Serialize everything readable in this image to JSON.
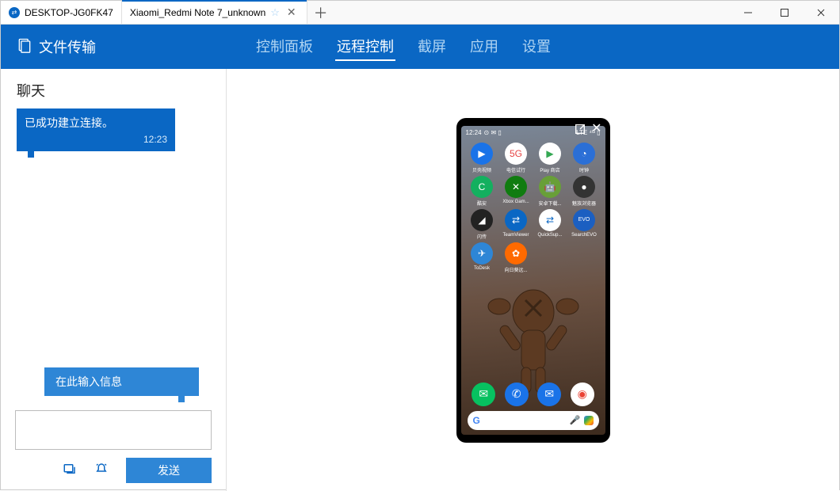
{
  "tabs": [
    {
      "label": "DESKTOP-JG0FK47"
    },
    {
      "label": "Xiaomi_Redmi Note 7_unknown"
    }
  ],
  "header": {
    "title": "文件传输"
  },
  "nav": [
    {
      "label": "控制面板",
      "active": false
    },
    {
      "label": "远程控制",
      "active": true
    },
    {
      "label": "截屏",
      "active": false
    },
    {
      "label": "应用",
      "active": false
    },
    {
      "label": "设置",
      "active": false
    }
  ],
  "chat": {
    "title": "聊天",
    "messages": [
      {
        "text": "已成功建立连接。",
        "time": "12:23"
      }
    ],
    "hint": "在此输入信息",
    "send": "发送"
  },
  "phone": {
    "status": {
      "time": "12:24",
      "right": "LTE ⁴ᴳ ▯"
    },
    "apps_row1": [
      {
        "label": "贝壳视频",
        "bg": "#1a73e8",
        "glyph": "▶"
      },
      {
        "label": "电信试行",
        "bg": "#ffffff",
        "glyph": "5G",
        "fg": "#e64545"
      },
      {
        "label": "Play 商店",
        "bg": "#ffffff",
        "glyph": "▶",
        "fg": "#34a853"
      },
      {
        "label": "时钟",
        "bg": "#2b6fd6",
        "glyph": "◔"
      }
    ],
    "apps_row2": [
      {
        "label": "酷安",
        "bg": "#13b05f",
        "glyph": "C"
      },
      {
        "label": "Xbox Gam...",
        "bg": "#107c10",
        "glyph": "✕"
      },
      {
        "label": "安卓下载...",
        "bg": "#689f38",
        "glyph": "🤖"
      },
      {
        "label": "魅族浏览器",
        "bg": "#333333",
        "glyph": "●"
      }
    ],
    "apps_row3": [
      {
        "label": "闪传",
        "bg": "#222222",
        "glyph": "◢"
      },
      {
        "label": "TeamViewer",
        "bg": "#0a67c4",
        "glyph": "⇄"
      },
      {
        "label": "QuickSup...",
        "bg": "#ffffff",
        "glyph": "⇄",
        "fg": "#0a67c4"
      },
      {
        "label": "SearchEVO",
        "bg": "#1b5fc1",
        "glyph": "EVO"
      }
    ],
    "apps_row4": [
      {
        "label": "ToDesk",
        "bg": "#2e86d6",
        "glyph": "✈"
      },
      {
        "label": "向日葵远...",
        "bg": "#ff6a00",
        "glyph": "✿"
      }
    ],
    "dock": [
      {
        "bg": "#07c160",
        "glyph": "✉"
      },
      {
        "bg": "#1a73e8",
        "glyph": "✆"
      },
      {
        "bg": "#1a73e8",
        "glyph": "✉"
      },
      {
        "bg": "#ffffff",
        "glyph": "◉"
      }
    ]
  }
}
